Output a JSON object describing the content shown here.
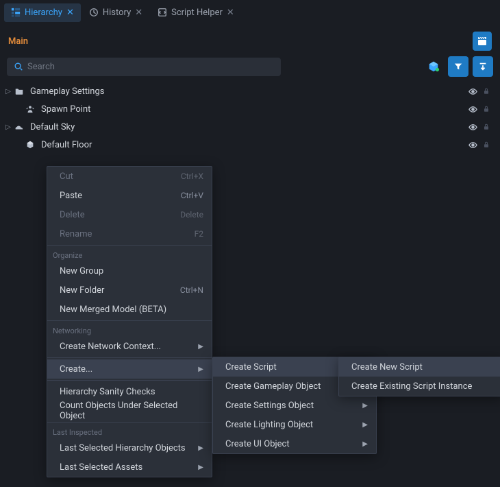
{
  "tabs": [
    {
      "label": "Hierarchy",
      "active": true
    },
    {
      "label": "History",
      "active": false
    },
    {
      "label": "Script Helper",
      "active": false
    }
  ],
  "panel": {
    "title": "Main"
  },
  "search": {
    "placeholder": "Search"
  },
  "hierarchy": [
    {
      "label": "Gameplay Settings",
      "expandable": true,
      "indent": 0,
      "icon": "folder"
    },
    {
      "label": "Spawn Point",
      "expandable": false,
      "indent": 1,
      "icon": "spawn"
    },
    {
      "label": "Default Sky",
      "expandable": true,
      "indent": 0,
      "icon": "sky"
    },
    {
      "label": "Default Floor",
      "expandable": false,
      "indent": 1,
      "icon": "cube"
    }
  ],
  "context_menu": {
    "groups": [
      {
        "section": null,
        "items": [
          {
            "label": "Cut",
            "shortcut": "Ctrl+X",
            "disabled": true
          },
          {
            "label": "Paste",
            "shortcut": "Ctrl+V",
            "disabled": false
          },
          {
            "label": "Delete",
            "shortcut": "Delete",
            "disabled": true
          },
          {
            "label": "Rename",
            "shortcut": "F2",
            "disabled": true
          }
        ]
      },
      {
        "section": "Organize",
        "items": [
          {
            "label": "New Group",
            "shortcut": ""
          },
          {
            "label": "New Folder",
            "shortcut": "Ctrl+N"
          },
          {
            "label": "New Merged Model (BETA)",
            "shortcut": ""
          }
        ]
      },
      {
        "section": "Networking",
        "items": [
          {
            "label": "Create Network Context...",
            "submenu": true
          }
        ]
      },
      {
        "section": "sep-only",
        "items": [
          {
            "label": "Create...",
            "submenu": true,
            "highlighted": true
          }
        ]
      },
      {
        "section": "sep-only",
        "items": [
          {
            "label": "Hierarchy Sanity Checks"
          },
          {
            "label": "Count Objects Under Selected Object"
          }
        ]
      },
      {
        "section": "Last Inspected",
        "items": [
          {
            "label": "Last Selected Hierarchy Objects",
            "submenu": true
          },
          {
            "label": "Last Selected Assets",
            "submenu": true
          }
        ]
      }
    ],
    "create_submenu": [
      {
        "label": "Create Script",
        "submenu": true,
        "highlighted": true
      },
      {
        "label": "Create Gameplay Object",
        "submenu": true
      },
      {
        "label": "Create Settings Object",
        "submenu": true
      },
      {
        "label": "Create Lighting Object",
        "submenu": true
      },
      {
        "label": "Create UI Object",
        "submenu": true
      }
    ],
    "script_submenu": [
      {
        "label": "Create New Script",
        "highlighted": true
      },
      {
        "label": "Create Existing Script Instance"
      }
    ]
  }
}
